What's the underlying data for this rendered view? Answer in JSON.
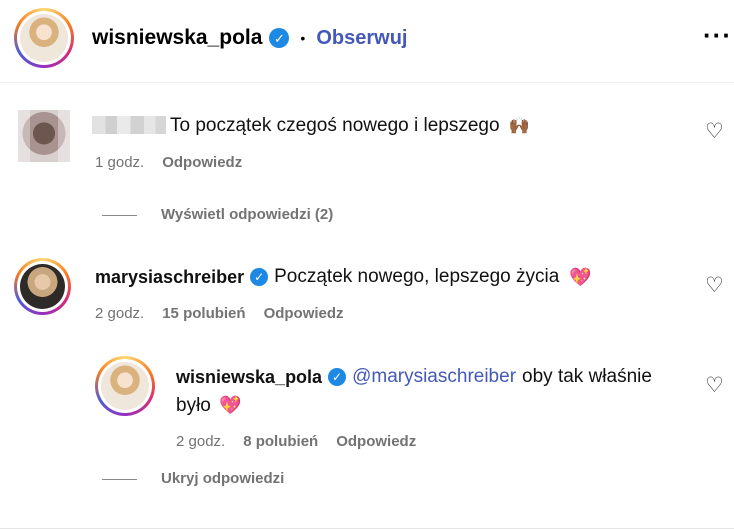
{
  "header": {
    "username": "wisniewska_pola",
    "dot": "•",
    "follow_label": "Obserwuj",
    "more_icon": "more-options-icon"
  },
  "comments": [
    {
      "text": "To początek czegoś nowego i lepszego",
      "emoji": "🙌🏾",
      "time": "1 godz.",
      "reply_label": "Odpowiedz",
      "view_replies_label": "Wyświetl odpowiedzi (2)"
    },
    {
      "username": "marysiaschreiber",
      "text": "Początek nowego, lepszego życia",
      "emoji": "💖",
      "time": "2 godz.",
      "likes": "15 polubień",
      "reply_label": "Odpowiedz",
      "reply": {
        "username": "wisniewska_pola",
        "mention": "@marysiaschreiber",
        "text_line1": "oby tak właśnie",
        "text_line2": "było",
        "emoji": "💖",
        "time": "2 godz.",
        "likes": "8 polubień",
        "reply_label": "Odpowiedz"
      },
      "hide_replies_label": "Ukryj odpowiedzi"
    }
  ],
  "colors": {
    "accent_link": "#4458b9",
    "verified": "#1e88e5",
    "meta_text": "#737373"
  }
}
